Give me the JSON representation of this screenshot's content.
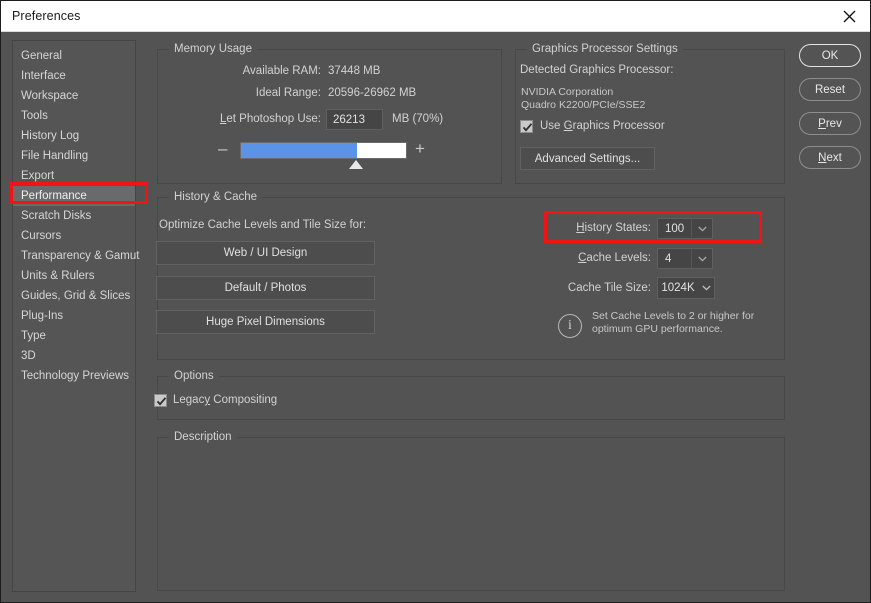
{
  "window": {
    "title": "Preferences",
    "close_icon": "close-icon"
  },
  "sidebar": {
    "items": [
      {
        "label": "General",
        "selected": false
      },
      {
        "label": "Interface",
        "selected": false
      },
      {
        "label": "Workspace",
        "selected": false
      },
      {
        "label": "Tools",
        "selected": false
      },
      {
        "label": "History Log",
        "selected": false
      },
      {
        "label": "File Handling",
        "selected": false
      },
      {
        "label": "Export",
        "selected": false
      },
      {
        "label": "Performance",
        "selected": true
      },
      {
        "label": "Scratch Disks",
        "selected": false
      },
      {
        "label": "Cursors",
        "selected": false
      },
      {
        "label": "Transparency & Gamut",
        "selected": false
      },
      {
        "label": "Units & Rulers",
        "selected": false
      },
      {
        "label": "Guides, Grid & Slices",
        "selected": false
      },
      {
        "label": "Plug-Ins",
        "selected": false
      },
      {
        "label": "Type",
        "selected": false
      },
      {
        "label": "3D",
        "selected": false
      },
      {
        "label": "Technology Previews",
        "selected": false
      }
    ]
  },
  "memory_usage": {
    "title": "Memory Usage",
    "available_ram_label": "Available RAM:",
    "available_ram_value": "37448 MB",
    "ideal_range_label": "Ideal Range:",
    "ideal_range_value": "20596-26962 MB",
    "let_photoshop_use_label": "Let Photoshop Use:",
    "let_photoshop_use_value": "26213",
    "let_photoshop_use_suffix": "MB (70%)",
    "slider_percent": 70,
    "minus_label": "–",
    "plus_label": "+"
  },
  "graphics": {
    "title": "Graphics Processor Settings",
    "detected_label": "Detected Graphics Processor:",
    "vendor": "NVIDIA Corporation",
    "model": "Quadro K2200/PCIe/SSE2",
    "use_gpu_label": "Use Graphics Processor",
    "use_gpu_checked": true,
    "advanced_button": "Advanced Settings..."
  },
  "history_cache": {
    "title": "History & Cache",
    "optimize_label": "Optimize Cache Levels and Tile Size for:",
    "preset_buttons": [
      "Web / UI Design",
      "Default / Photos",
      "Huge Pixel Dimensions"
    ],
    "history_states_label": "History States:",
    "history_states_value": "100",
    "cache_levels_label": "Cache Levels:",
    "cache_levels_value": "4",
    "cache_tile_size_label": "Cache Tile Size:",
    "cache_tile_size_value": "1024K",
    "info_icon": "info-icon",
    "info_text_line1": "Set Cache Levels to 2 or higher for",
    "info_text_line2": "optimum GPU performance."
  },
  "options": {
    "title": "Options",
    "legacy_compositing_label": "Legacy Compositing",
    "legacy_compositing_checked": true
  },
  "description": {
    "title": "Description"
  },
  "buttons": {
    "ok": "OK",
    "reset": "Reset",
    "prev": "Prev",
    "next": "Next"
  },
  "annotations": {
    "highlight_color": "#f01414",
    "highlighted_items": [
      "Performance",
      "History States:"
    ]
  }
}
